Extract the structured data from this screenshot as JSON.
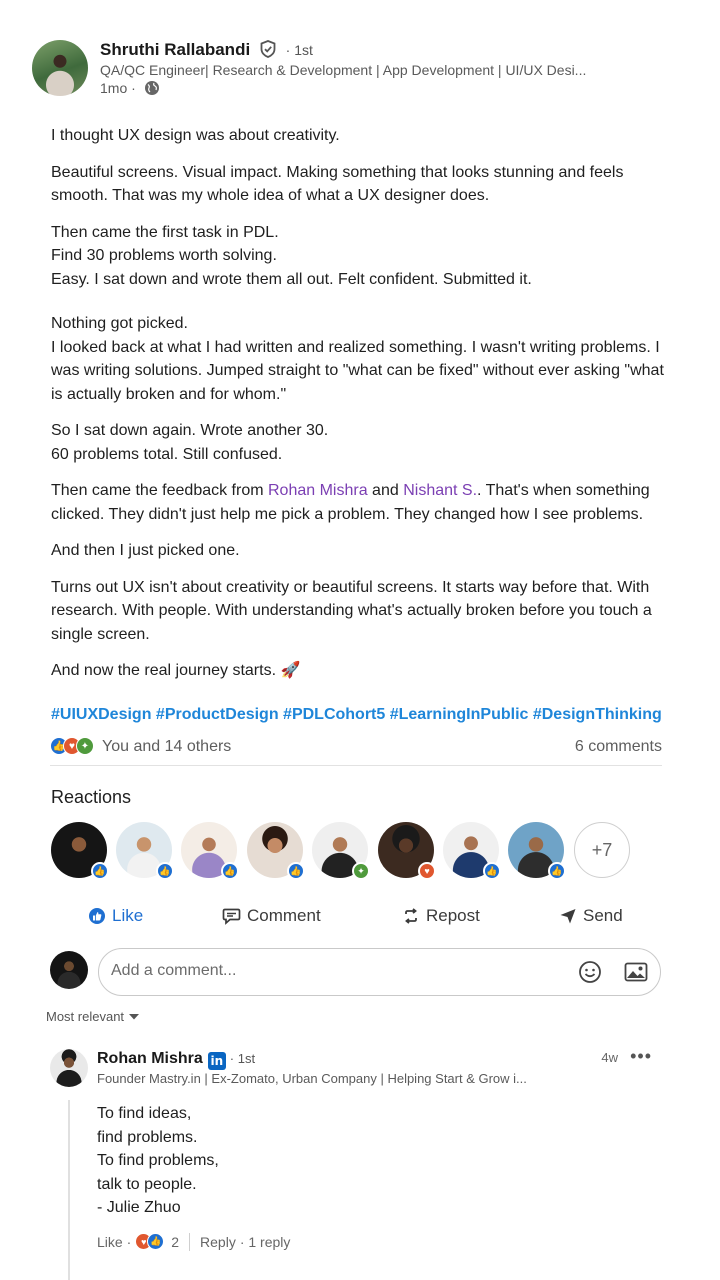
{
  "post": {
    "author": {
      "name": "Shruthi Rallabandi",
      "degree": "· 1st",
      "headline": "QA/QC Engineer| Research & Development | App Development | UI/UX Desi...",
      "time": "1mo ·"
    },
    "paragraphs": {
      "p1": "I thought UX design was about creativity.",
      "p2": "Beautiful screens. Visual impact. Making something that looks stunning and feels smooth. That was my whole idea of what a UX designer does.",
      "p3a": "Then came the first task in PDL.",
      "p3b": "Find 30 problems worth solving.",
      "p3c": "Easy. I sat down and wrote them all out. Felt confident. Submitted it.",
      "p4a": "Nothing got picked.",
      "p4b": "I looked back at what I had written and realized something. I wasn't writing problems. I was writing solutions. Jumped straight to \"what can be fixed\" without ever asking \"what is actually broken and for whom.\"",
      "p5a": "So I sat down again. Wrote another 30.",
      "p5b": "60 problems total. Still confused.",
      "p6_pre": "Then came the feedback from ",
      "p6_mention1": "Rohan Mishra",
      "p6_mid": " and ",
      "p6_mention2": "Nishant S.",
      "p6_post": ". That's when something clicked. They didn't just help me pick a problem. They changed how I see problems.",
      "p7": "And then I just picked one.",
      "p8": "Turns out UX isn't about creativity or beautiful screens. It starts way before that. With research. With people. With understanding what's actually broken before you touch a single screen.",
      "p9": "And now the real journey starts. 🚀"
    },
    "hashtags": "#UIUXDesign #ProductDesign #PDLCohort5 #LearningInPublic #DesignThinking",
    "reactions_text": "You and 14 others",
    "comments_count": "6 comments"
  },
  "reactions_panel": {
    "title": "Reactions",
    "more": "+7"
  },
  "actions": {
    "like": "Like",
    "comment": "Comment",
    "repost": "Repost",
    "send": "Send"
  },
  "comment_box": {
    "placeholder": "Add a comment..."
  },
  "sort": {
    "label": "Most relevant"
  },
  "comment": {
    "name": "Rohan Mishra",
    "degree": "· 1st",
    "headline": "Founder Mastry.in | Ex-Zomato, Urban Company | Helping Start & Grow i...",
    "time": "4w",
    "lines": {
      "l1": "To find ideas,",
      "l2": "find problems.",
      "l3": "To find problems,",
      "l4": "talk to people.",
      "l5": "- Julie Zhuo"
    },
    "like": "Like ·",
    "reaction_count": "2",
    "reply": "Reply",
    "replies": "· 1 reply"
  },
  "colors": {
    "mention": "#7b3fb3",
    "hashtag": "#1f86d9",
    "like_blue": "#1f6fd1",
    "linkedin_blue": "#0a66c2"
  }
}
